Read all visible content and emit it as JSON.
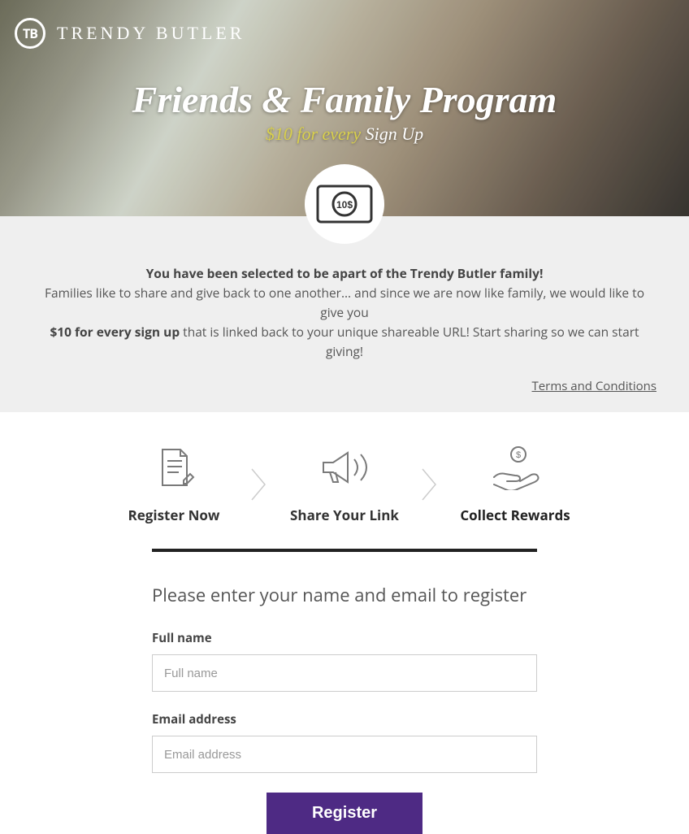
{
  "brand": "TRENDY BUTLER",
  "logo_initials": "TB",
  "hero": {
    "title": "Friends & Family Program",
    "sub_prefix": "$10 for every",
    "sub_rest": " Sign Up"
  },
  "intro": {
    "lead": "You have been selected to be apart of the Trendy Butler family!",
    "line2a": "Families like to share and give back to one another… and since we are now like family, we would like to give you ",
    "line2b": "$10 for every sign up",
    "line2c": " that is linked back to your unique shareable URL! Start sharing so we can start giving!",
    "terms": "Terms and Conditions"
  },
  "steps": {
    "s1": "Register Now",
    "s2": "Share Your Link",
    "s3": "Collect Rewards"
  },
  "form": {
    "heading": "Please enter your name and email to register",
    "fullname_label": "Full name",
    "fullname_placeholder": "Full name",
    "email_label": "Email address",
    "email_placeholder": "Email address",
    "submit": "Register"
  },
  "colors": {
    "accent": "#4e2a84",
    "gold": "#d9d04c"
  }
}
